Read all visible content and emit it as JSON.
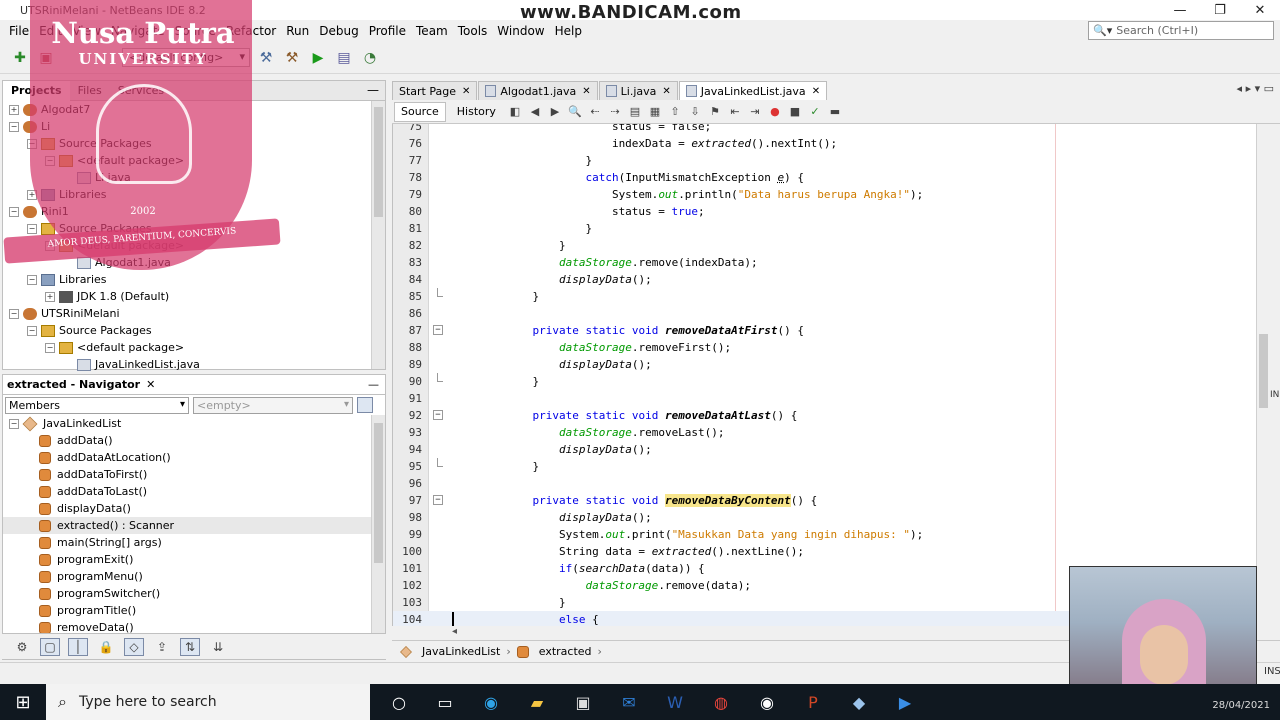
{
  "window": {
    "title": "UTSRiniMelani - NetBeans IDE 8.2",
    "watermark": "www.BANDICAM.com",
    "controls": [
      "—",
      "❐",
      "✕"
    ]
  },
  "menu": [
    "File",
    "Edit",
    "View",
    "Navigate",
    "Source",
    "Refactor",
    "Run",
    "Debug",
    "Profile",
    "Team",
    "Tools",
    "Window",
    "Help"
  ],
  "search": {
    "placeholder": "Search (Ctrl+I)"
  },
  "toolbar": {
    "config": "<default config>"
  },
  "projects_panel": {
    "tabs": [
      "Projects",
      "Files",
      "Services"
    ],
    "tree": [
      {
        "label": "Algodat7",
        "indent": 0,
        "icon": "project-icon",
        "exp": "+"
      },
      {
        "label": "Li",
        "indent": 0,
        "icon": "project-icon",
        "exp": "−"
      },
      {
        "label": "Source Packages",
        "indent": 1,
        "icon": "package-icon",
        "exp": "−"
      },
      {
        "label": "<default package>",
        "indent": 2,
        "icon": "package-icon",
        "exp": "−"
      },
      {
        "label": "Li.java",
        "indent": 3,
        "icon": "java-file-icon",
        "exp": ""
      },
      {
        "label": "Libraries",
        "indent": 1,
        "icon": "library-icon",
        "exp": "+"
      },
      {
        "label": "Rini1",
        "indent": 0,
        "icon": "project-icon",
        "exp": "−"
      },
      {
        "label": "Source Packages",
        "indent": 1,
        "icon": "package-icon",
        "exp": "−"
      },
      {
        "label": "<default package>",
        "indent": 2,
        "icon": "package-icon",
        "exp": "−"
      },
      {
        "label": "Algodat1.java",
        "indent": 3,
        "icon": "java-file-icon",
        "exp": ""
      },
      {
        "label": "Libraries",
        "indent": 1,
        "icon": "library-icon",
        "exp": "−"
      },
      {
        "label": "JDK 1.8 (Default)",
        "indent": 2,
        "icon": "jdk-icon",
        "exp": "+"
      },
      {
        "label": "UTSRiniMelani",
        "indent": 0,
        "icon": "project-icon",
        "exp": "−"
      },
      {
        "label": "Source Packages",
        "indent": 1,
        "icon": "package-icon",
        "exp": "−"
      },
      {
        "label": "<default package>",
        "indent": 2,
        "icon": "package-icon",
        "exp": "−"
      },
      {
        "label": "JavaLinkedList.java",
        "indent": 3,
        "icon": "java-file-icon",
        "exp": ""
      }
    ]
  },
  "logo": {
    "name": "Nusa Putra",
    "subtitle": "UNIVERSITY",
    "year": "2002",
    "motto": "AMOR DEUS, PARENTIUM, CONCERVIS"
  },
  "navigator": {
    "title": "extracted - Navigator",
    "filter": "Members",
    "filter2": "<empty>",
    "class_name": "JavaLinkedList",
    "members": [
      "addData()",
      "addDataAtLocation()",
      "addDataToFirst()",
      "addDataToLast()",
      "displayData()",
      "extracted() : Scanner",
      "main(String[] args)",
      "programExit()",
      "programMenu()",
      "programSwitcher()",
      "programTitle()",
      "removeData()"
    ]
  },
  "editor": {
    "tabs": [
      "Start Page",
      "Algodat1.java",
      "Li.java",
      "JavaLinkedList.java"
    ],
    "source_label": "Source",
    "history_label": "History",
    "lines": [
      {
        "n": "75",
        "html": "                        status = false;"
      },
      {
        "n": "76",
        "html": "                        indexData = <i>extracted</i>().nextInt();"
      },
      {
        "n": "77",
        "html": "                    }"
      },
      {
        "n": "78",
        "html": "                    <k>catch</k>(InputMismatchException <u>e</u>) {"
      },
      {
        "n": "79",
        "html": "                        System.<f>out</f>.println(<s>\"Data harus berupa Angka!\"</s>);"
      },
      {
        "n": "80",
        "html": "                        status = <k>true</k>;"
      },
      {
        "n": "81",
        "html": "                    }"
      },
      {
        "n": "82",
        "html": "                }"
      },
      {
        "n": "83",
        "html": "                <f>dataStorage</f>.remove(indexData);"
      },
      {
        "n": "84",
        "html": "                <i>displayData</i>();"
      },
      {
        "n": "85",
        "html": "            }"
      },
      {
        "n": "86",
        "html": ""
      },
      {
        "n": "87",
        "html": "            <k>private static void</k> <m>removeDataAtFirst</m>() {"
      },
      {
        "n": "88",
        "html": "                <f>dataStorage</f>.removeFirst();"
      },
      {
        "n": "89",
        "html": "                <i>displayData</i>();"
      },
      {
        "n": "90",
        "html": "            }"
      },
      {
        "n": "91",
        "html": ""
      },
      {
        "n": "92",
        "html": "            <k>private static void</k> <m>removeDataAtLast</m>() {"
      },
      {
        "n": "93",
        "html": "                <f>dataStorage</f>.removeLast();"
      },
      {
        "n": "94",
        "html": "                <i>displayData</i>();"
      },
      {
        "n": "95",
        "html": "            }"
      },
      {
        "n": "96",
        "html": ""
      },
      {
        "n": "97",
        "html": "            <k>private static void</k> <h>removeDataByContent</h>() {"
      },
      {
        "n": "98",
        "html": "                <i>displayData</i>();"
      },
      {
        "n": "99",
        "html": "                System.<f>out</f>.print(<s>\"Masukkan Data yang ingin dihapus: \"</s>);"
      },
      {
        "n": "100",
        "html": "                String data = <i>extracted</i>().nextLine();"
      },
      {
        "n": "101",
        "html": "                <k>if</k>(<i>searchData</i>(data)) {"
      },
      {
        "n": "102",
        "html": "                    <f>dataStorage</f>.remove(data);"
      },
      {
        "n": "103",
        "html": "                }"
      },
      {
        "n": "104",
        "html": "                <k>else</k> {"
      }
    ],
    "fold_lines": [
      "87",
      "92",
      "97"
    ],
    "fold_end_lines": [
      "85",
      "90",
      "95"
    ],
    "current_line": "104"
  },
  "breadcrumbs": [
    "JavaLinkedList",
    "extracted"
  ],
  "status": {
    "mode": "INS"
  },
  "taskbar": {
    "search_placeholder": "Type here to search",
    "date": "28/04/2021"
  }
}
